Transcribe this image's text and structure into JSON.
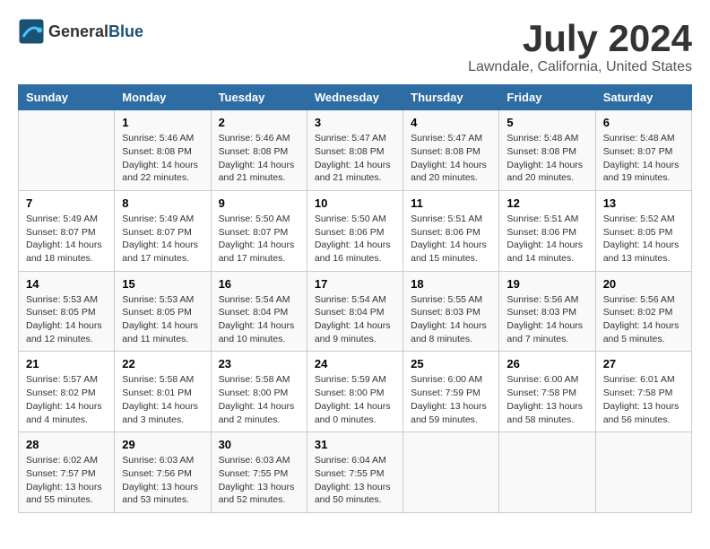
{
  "logo": {
    "text_general": "General",
    "text_blue": "Blue"
  },
  "title": "July 2024",
  "location": "Lawndale, California, United States",
  "days_of_week": [
    "Sunday",
    "Monday",
    "Tuesday",
    "Wednesday",
    "Thursday",
    "Friday",
    "Saturday"
  ],
  "weeks": [
    [
      {
        "day": "",
        "detail": ""
      },
      {
        "day": "1",
        "detail": "Sunrise: 5:46 AM\nSunset: 8:08 PM\nDaylight: 14 hours\nand 22 minutes."
      },
      {
        "day": "2",
        "detail": "Sunrise: 5:46 AM\nSunset: 8:08 PM\nDaylight: 14 hours\nand 21 minutes."
      },
      {
        "day": "3",
        "detail": "Sunrise: 5:47 AM\nSunset: 8:08 PM\nDaylight: 14 hours\nand 21 minutes."
      },
      {
        "day": "4",
        "detail": "Sunrise: 5:47 AM\nSunset: 8:08 PM\nDaylight: 14 hours\nand 20 minutes."
      },
      {
        "day": "5",
        "detail": "Sunrise: 5:48 AM\nSunset: 8:08 PM\nDaylight: 14 hours\nand 20 minutes."
      },
      {
        "day": "6",
        "detail": "Sunrise: 5:48 AM\nSunset: 8:07 PM\nDaylight: 14 hours\nand 19 minutes."
      }
    ],
    [
      {
        "day": "7",
        "detail": "Sunrise: 5:49 AM\nSunset: 8:07 PM\nDaylight: 14 hours\nand 18 minutes."
      },
      {
        "day": "8",
        "detail": "Sunrise: 5:49 AM\nSunset: 8:07 PM\nDaylight: 14 hours\nand 17 minutes."
      },
      {
        "day": "9",
        "detail": "Sunrise: 5:50 AM\nSunset: 8:07 PM\nDaylight: 14 hours\nand 17 minutes."
      },
      {
        "day": "10",
        "detail": "Sunrise: 5:50 AM\nSunset: 8:06 PM\nDaylight: 14 hours\nand 16 minutes."
      },
      {
        "day": "11",
        "detail": "Sunrise: 5:51 AM\nSunset: 8:06 PM\nDaylight: 14 hours\nand 15 minutes."
      },
      {
        "day": "12",
        "detail": "Sunrise: 5:51 AM\nSunset: 8:06 PM\nDaylight: 14 hours\nand 14 minutes."
      },
      {
        "day": "13",
        "detail": "Sunrise: 5:52 AM\nSunset: 8:05 PM\nDaylight: 14 hours\nand 13 minutes."
      }
    ],
    [
      {
        "day": "14",
        "detail": "Sunrise: 5:53 AM\nSunset: 8:05 PM\nDaylight: 14 hours\nand 12 minutes."
      },
      {
        "day": "15",
        "detail": "Sunrise: 5:53 AM\nSunset: 8:05 PM\nDaylight: 14 hours\nand 11 minutes."
      },
      {
        "day": "16",
        "detail": "Sunrise: 5:54 AM\nSunset: 8:04 PM\nDaylight: 14 hours\nand 10 minutes."
      },
      {
        "day": "17",
        "detail": "Sunrise: 5:54 AM\nSunset: 8:04 PM\nDaylight: 14 hours\nand 9 minutes."
      },
      {
        "day": "18",
        "detail": "Sunrise: 5:55 AM\nSunset: 8:03 PM\nDaylight: 14 hours\nand 8 minutes."
      },
      {
        "day": "19",
        "detail": "Sunrise: 5:56 AM\nSunset: 8:03 PM\nDaylight: 14 hours\nand 7 minutes."
      },
      {
        "day": "20",
        "detail": "Sunrise: 5:56 AM\nSunset: 8:02 PM\nDaylight: 14 hours\nand 5 minutes."
      }
    ],
    [
      {
        "day": "21",
        "detail": "Sunrise: 5:57 AM\nSunset: 8:02 PM\nDaylight: 14 hours\nand 4 minutes."
      },
      {
        "day": "22",
        "detail": "Sunrise: 5:58 AM\nSunset: 8:01 PM\nDaylight: 14 hours\nand 3 minutes."
      },
      {
        "day": "23",
        "detail": "Sunrise: 5:58 AM\nSunset: 8:00 PM\nDaylight: 14 hours\nand 2 minutes."
      },
      {
        "day": "24",
        "detail": "Sunrise: 5:59 AM\nSunset: 8:00 PM\nDaylight: 14 hours\nand 0 minutes."
      },
      {
        "day": "25",
        "detail": "Sunrise: 6:00 AM\nSunset: 7:59 PM\nDaylight: 13 hours\nand 59 minutes."
      },
      {
        "day": "26",
        "detail": "Sunrise: 6:00 AM\nSunset: 7:58 PM\nDaylight: 13 hours\nand 58 minutes."
      },
      {
        "day": "27",
        "detail": "Sunrise: 6:01 AM\nSunset: 7:58 PM\nDaylight: 13 hours\nand 56 minutes."
      }
    ],
    [
      {
        "day": "28",
        "detail": "Sunrise: 6:02 AM\nSunset: 7:57 PM\nDaylight: 13 hours\nand 55 minutes."
      },
      {
        "day": "29",
        "detail": "Sunrise: 6:03 AM\nSunset: 7:56 PM\nDaylight: 13 hours\nand 53 minutes."
      },
      {
        "day": "30",
        "detail": "Sunrise: 6:03 AM\nSunset: 7:55 PM\nDaylight: 13 hours\nand 52 minutes."
      },
      {
        "day": "31",
        "detail": "Sunrise: 6:04 AM\nSunset: 7:55 PM\nDaylight: 13 hours\nand 50 minutes."
      },
      {
        "day": "",
        "detail": ""
      },
      {
        "day": "",
        "detail": ""
      },
      {
        "day": "",
        "detail": ""
      }
    ]
  ]
}
